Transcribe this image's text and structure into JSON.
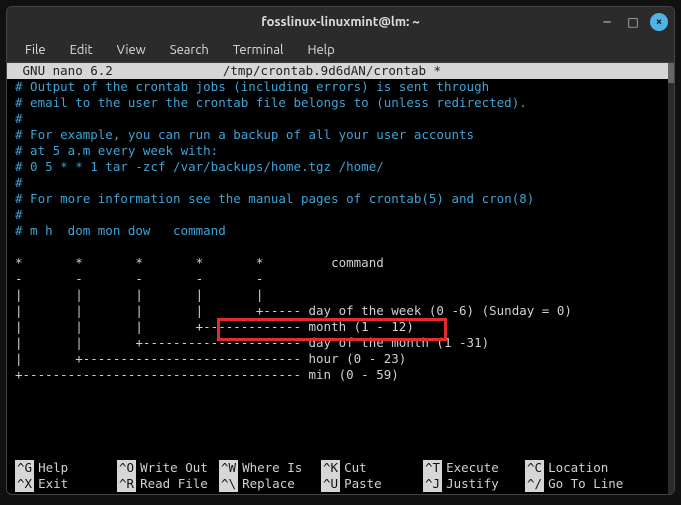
{
  "titlebar": {
    "title": "fosslinux-linuxmint@lm: ~"
  },
  "menubar": [
    "File",
    "Edit",
    "View",
    "Search",
    "Terminal",
    "Help"
  ],
  "nano": {
    "version": " GNU nano 6.2",
    "filepath": "/tmp/crontab.9d6dAN/crontab *",
    "lines": [
      {
        "cls": "comment",
        "text": "# Output of the crontab jobs (including errors) is sent through"
      },
      {
        "cls": "comment",
        "text": "# email to the user the crontab file belongs to (unless redirected)."
      },
      {
        "cls": "comment",
        "text": "#"
      },
      {
        "cls": "comment",
        "text": "# For example, you can run a backup of all your user accounts"
      },
      {
        "cls": "comment",
        "text": "# at 5 a.m every week with:"
      },
      {
        "cls": "comment",
        "text": "# 0 5 * * 1 tar -zcf /var/backups/home.tgz /home/"
      },
      {
        "cls": "comment",
        "text": "#"
      },
      {
        "cls": "comment",
        "text": "# For more information see the manual pages of crontab(5) and cron(8)"
      },
      {
        "cls": "comment",
        "text": "#"
      },
      {
        "cls": "comment",
        "text": "# m h  dom mon dow   command"
      },
      {
        "cls": "plain",
        "text": ""
      },
      {
        "cls": "plain",
        "text": "*       *       *       *       *         command"
      },
      {
        "cls": "plain",
        "text": "-       -       -       -       -"
      },
      {
        "cls": "plain",
        "text": "|       |       |       |       |"
      },
      {
        "cls": "plain",
        "text": "|       |       |       |       +----- day of the week (0 -6) (Sunday = 0)"
      },
      {
        "cls": "plain",
        "text": "|       |       |       +------------- month (1 - 12)"
      },
      {
        "cls": "plain",
        "text": "|       |       +--------------------- day of the month (1 -31)"
      },
      {
        "cls": "plain",
        "text": "|       +----------------------------- hour (0 - 23)"
      },
      {
        "cls": "plain",
        "text": "+------------------------------------- min (0 - 59)"
      }
    ],
    "shortcuts_row1": [
      {
        "key": "^G",
        "label": "Help"
      },
      {
        "key": "^O",
        "label": "Write Out"
      },
      {
        "key": "^W",
        "label": "Where Is"
      },
      {
        "key": "^K",
        "label": "Cut"
      },
      {
        "key": "^T",
        "label": "Execute"
      },
      {
        "key": "^C",
        "label": "Location"
      }
    ],
    "shortcuts_row2": [
      {
        "key": "^X",
        "label": "Exit"
      },
      {
        "key": "^R",
        "label": "Read File"
      },
      {
        "key": "^\\",
        "label": "Replace"
      },
      {
        "key": "^U",
        "label": "Paste"
      },
      {
        "key": "^J",
        "label": "Justify"
      },
      {
        "key": "^/",
        "label": "Go To Line"
      }
    ]
  }
}
